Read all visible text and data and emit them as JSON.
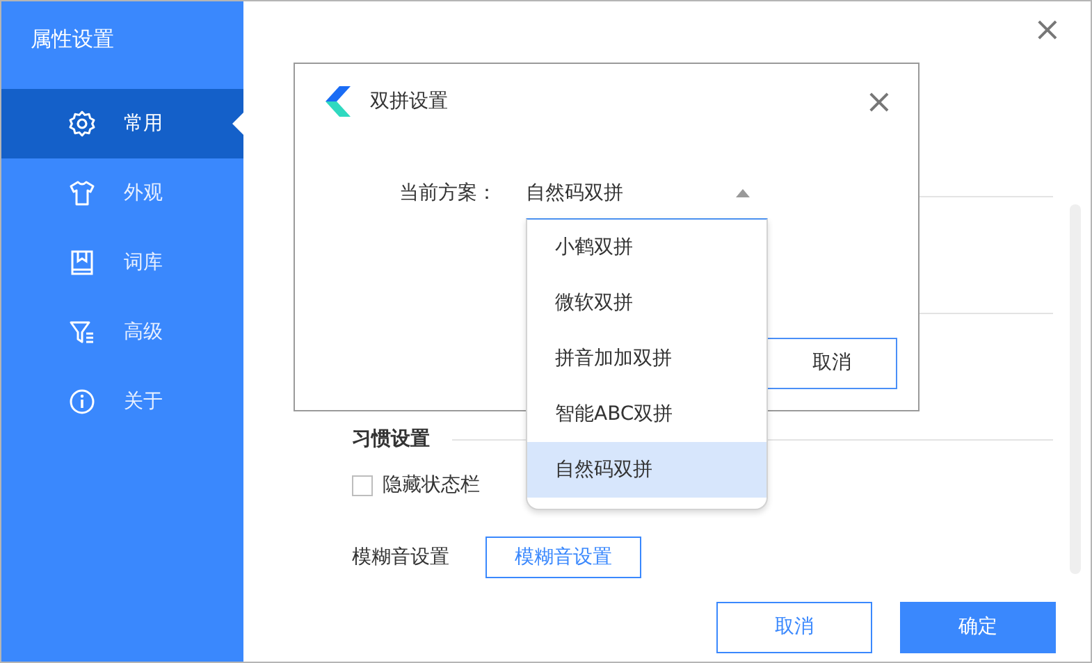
{
  "window": {
    "title": "属性设置",
    "close": "×"
  },
  "sidebar": {
    "items": [
      {
        "label": "常用",
        "selected": true
      },
      {
        "label": "外观",
        "selected": false
      },
      {
        "label": "词库",
        "selected": false
      },
      {
        "label": "高级",
        "selected": false
      },
      {
        "label": "关于",
        "selected": false
      }
    ]
  },
  "main": {
    "habit": {
      "heading": "习惯设置",
      "checkboxes": [
        {
          "label": "隐藏状态栏",
          "checked": false
        }
      ]
    },
    "fuzzy": {
      "label": "模糊音设置",
      "button": "模糊音设置"
    },
    "buttons": [
      {
        "label": "取消",
        "kind": "secondary"
      },
      {
        "label": "确定",
        "kind": "primary"
      }
    ]
  },
  "dialog": {
    "title": "双拼设置",
    "close": "×",
    "field_label": "当前方案：",
    "value": "自然码双拼",
    "expanded": true,
    "options": [
      {
        "label": "小鹤双拼",
        "selected": false
      },
      {
        "label": "微软双拼",
        "selected": false
      },
      {
        "label": "拼音加加双拼",
        "selected": false
      },
      {
        "label": "智能ABC双拼",
        "selected": false
      },
      {
        "label": "自然码双拼",
        "selected": true
      }
    ],
    "cancel_button": "取消"
  }
}
